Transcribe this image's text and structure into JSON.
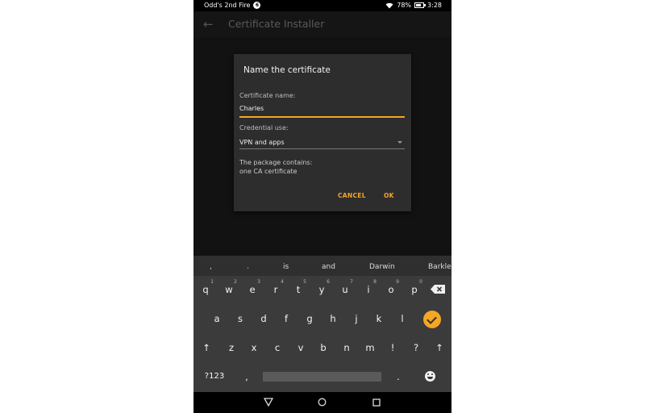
{
  "status_bar": {
    "device_name": "Odd's 2nd Fire",
    "notification_badge": "6",
    "battery": "78%",
    "time": "3:28"
  },
  "app_bar": {
    "title": "Certificate Installer"
  },
  "dialog": {
    "title": "Name the certificate",
    "cert_name_label": "Certificate name:",
    "cert_name_value": "Charles",
    "credential_use_label": "Credential use:",
    "credential_use_value": "VPN and apps",
    "package_line1": "The package contains:",
    "package_line2": "one CA certificate",
    "cancel_label": "CANCEL",
    "ok_label": "OK"
  },
  "keyboard": {
    "suggestions": [
      ",",
      ".",
      "is",
      "and",
      "Darwin",
      "Barkle"
    ],
    "row1": [
      "q",
      "w",
      "e",
      "r",
      "t",
      "y",
      "u",
      "i",
      "o",
      "p"
    ],
    "row1_hints": [
      "1",
      "2",
      "3",
      "4",
      "5",
      "6",
      "7",
      "8",
      "9",
      "0"
    ],
    "row2": [
      "a",
      "s",
      "d",
      "f",
      "g",
      "h",
      "j",
      "k",
      "l"
    ],
    "row3": [
      "z",
      "x",
      "c",
      "v",
      "b",
      "n",
      "m",
      "!",
      "?"
    ],
    "shift": "↑",
    "symbols_label": "?123",
    "comma": ",",
    "period": "."
  },
  "colors": {
    "accent": "#f5a623",
    "dialog_bg": "#2d2d2d",
    "keyboard_bg": "#3b3b3b"
  }
}
